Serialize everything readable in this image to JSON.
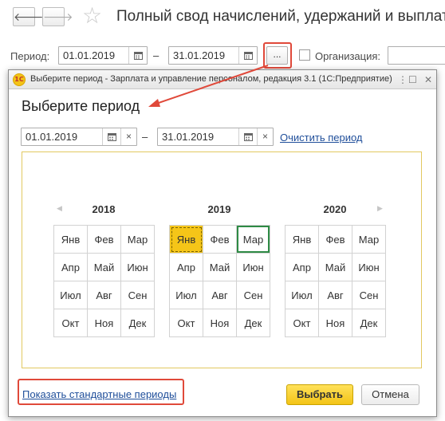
{
  "report": {
    "back_icon": "arrow-left-icon",
    "forward_icon": "arrow-right-icon",
    "favorite_icon": "star-icon",
    "title": "Полный свод начислений, удержаний и выплат",
    "period_label": "Период:",
    "date_from": "01.01.2019",
    "date_to": "31.01.2019",
    "range_dash": "–",
    "select_period_button": "...",
    "organization_label": "Организация:",
    "organization_checked": false
  },
  "dialog": {
    "window_title": "Выберите период - Зарплата и управление персоналом, редакция 3.1  (1С:Предприятие)",
    "logo_text": "1С",
    "window_icons": [
      "menu-icon",
      "minimize-icon",
      "maximize-icon",
      "close-icon"
    ],
    "header": "Выберите период",
    "date_from": "01.01.2019",
    "date_to": "31.01.2019",
    "range_dash": "–",
    "clear_label": "×",
    "clear_period_link": "Очистить период",
    "years": [
      {
        "label": "2018",
        "months": [
          "Янв",
          "Фев",
          "Мар",
          "Апр",
          "Май",
          "Июн",
          "Июл",
          "Авг",
          "Сен",
          "Окт",
          "Ноя",
          "Дек"
        ]
      },
      {
        "label": "2019",
        "months": [
          "Янв",
          "Фев",
          "Мар",
          "Апр",
          "Май",
          "Июн",
          "Июл",
          "Авг",
          "Сен",
          "Окт",
          "Ноя",
          "Дек"
        ]
      },
      {
        "label": "2020",
        "months": [
          "Янв",
          "Фев",
          "Мар",
          "Апр",
          "Май",
          "Июн",
          "Июл",
          "Авг",
          "Сен",
          "Окт",
          "Ноя",
          "Дек"
        ]
      }
    ],
    "prev_arrow": "◀",
    "next_arrow": "▶",
    "selected_start": "2019 Янв",
    "selected_end": "2019 Мар",
    "standard_periods_link": "Показать стандартные периоды",
    "ok_button": "Выбрать",
    "cancel_button": "Отмена"
  },
  "colors": {
    "accent_yellow": "#f5c518",
    "highlight_red": "#e0493a",
    "link_blue": "#1f4e9a",
    "selection_green": "#2e8b45"
  }
}
